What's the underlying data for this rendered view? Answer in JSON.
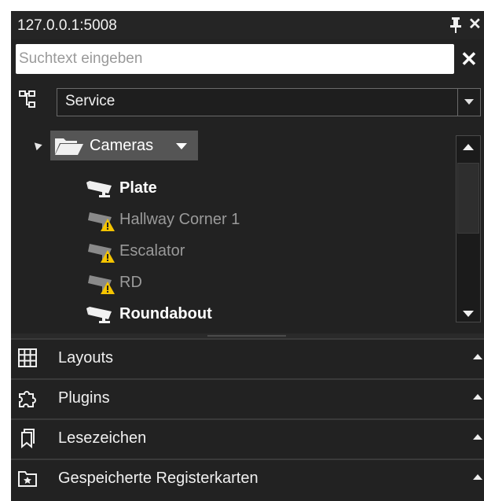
{
  "window": {
    "title": "127.0.0.1:5008"
  },
  "search": {
    "placeholder": "Suchtext eingeben",
    "value": ""
  },
  "view_selector": {
    "selected": "Service"
  },
  "tree": {
    "root": {
      "label": "Cameras",
      "expanded": true
    },
    "cameras": [
      {
        "label": "Plate",
        "status": "ok"
      },
      {
        "label": "Hallway Corner 1",
        "status": "warning"
      },
      {
        "label": "Escalator",
        "status": "warning"
      },
      {
        "label": "RD",
        "status": "warning"
      },
      {
        "label": "Roundabout",
        "status": "ok"
      }
    ]
  },
  "sections": [
    {
      "label": "Layouts",
      "icon": "grid-icon"
    },
    {
      "label": "Plugins",
      "icon": "puzzle-icon"
    },
    {
      "label": "Lesezeichen",
      "icon": "bookmark-icon"
    },
    {
      "label": "Gespeicherte Registerkarten",
      "icon": "saved-tabs-icon"
    }
  ],
  "colors": {
    "panel_bg": "#222222",
    "selected_node": "#555555",
    "warning": "#f5c400",
    "offline_text": "#9a9a9a"
  }
}
